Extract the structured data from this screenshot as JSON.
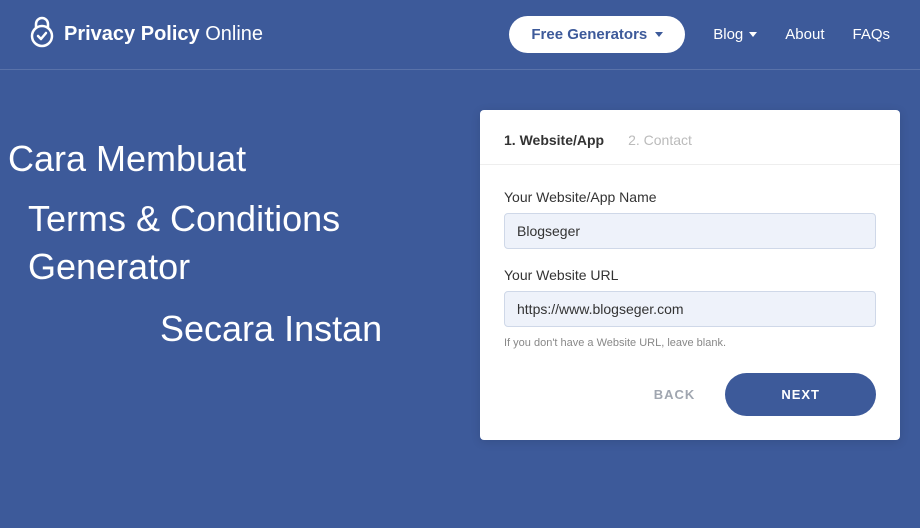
{
  "header": {
    "logo_bold": "Privacy Policy",
    "logo_light": " Online",
    "nav": {
      "generators": "Free Generators",
      "blog": "Blog",
      "about": "About",
      "faqs": "FAQs"
    }
  },
  "hero": {
    "line1": "Cara Membuat",
    "line2": "Terms & Conditions",
    "line3": "Generator",
    "line4": "Secara Instan"
  },
  "card": {
    "steps": {
      "step1": "1. Website/App",
      "step2": "2. Contact"
    },
    "name_label": "Your Website/App Name",
    "name_value": "Blogseger",
    "url_label": "Your Website URL",
    "url_value": "https://www.blogseger.com",
    "hint": "If you don't have a Website URL, leave blank.",
    "back": "BACK",
    "next": "NEXT"
  }
}
